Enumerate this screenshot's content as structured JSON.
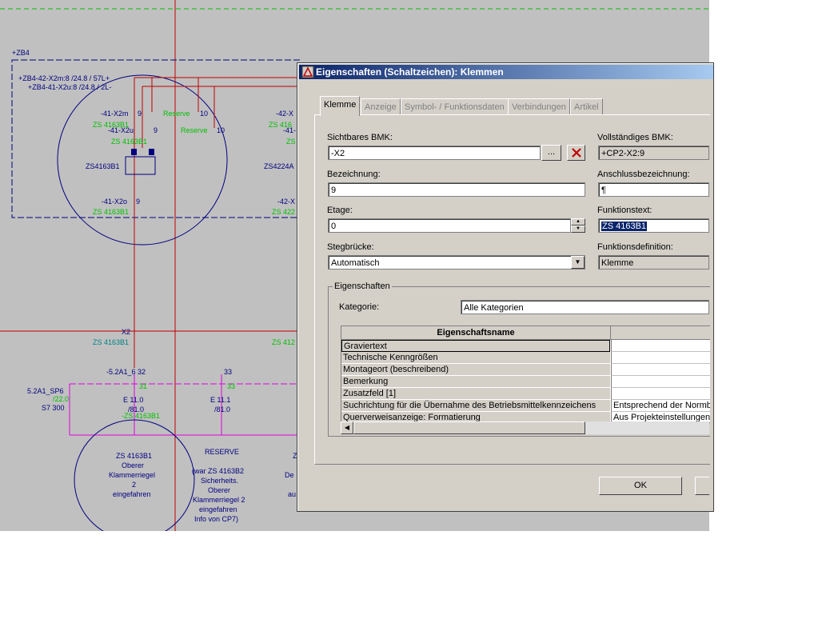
{
  "dialog": {
    "title": "Eigenschaften (Schaltzeichen): Klemmen",
    "tabs": [
      {
        "label": "Klemme"
      },
      {
        "label": "Anzeige"
      },
      {
        "label": "Symbol- / Funktionsdaten"
      },
      {
        "label": "Verbindungen"
      },
      {
        "label": "Artikel"
      }
    ],
    "fields": {
      "sichtbares_bmk": {
        "label": "Sichtbares BMK:",
        "value": "-X2"
      },
      "vollstaendiges_bmk": {
        "label": "Vollständiges BMK:",
        "value": "+CP2-X2:9"
      },
      "bezeichnung": {
        "label": "Bezeichnung:",
        "value": "9"
      },
      "anschlussbezeichnung": {
        "label": "Anschlussbezeichnung:",
        "value": "¶"
      },
      "etage": {
        "label": "Etage:",
        "value": "0"
      },
      "funktionstext": {
        "label": "Funktionstext:",
        "value": "ZS 4163B1"
      },
      "stegbruecke": {
        "label": "Stegbrücke:",
        "value": "Automatisch"
      },
      "funktionsdefinition": {
        "label": "Funktionsdefinition:",
        "value": "Klemme"
      }
    },
    "browse_label": "...",
    "properties": {
      "group_label": "Eigenschaften",
      "kategorie_label": "Kategorie:",
      "kategorie_value": "Alle Kategorien",
      "column_name": "Eigenschaftsname",
      "rows": [
        {
          "name": "Graviertext",
          "value": ""
        },
        {
          "name": "Technische Kenngrößen",
          "value": ""
        },
        {
          "name": "Montageort (beschreibend)",
          "value": ""
        },
        {
          "name": "Bemerkung",
          "value": ""
        },
        {
          "name": "Zusatzfeld [1]",
          "value": ""
        },
        {
          "name": "Suchrichtung für die Übernahme des Betriebsmittelkennzeichens",
          "value": "Entsprechend der Normbl"
        },
        {
          "name": "Querverweisanzeige: Formatierung",
          "value": "Aus Projekteinstellungen"
        }
      ]
    },
    "ok_label": "OK"
  },
  "schematic": {
    "labels": {
      "zb4": "+ZB4",
      "wire1": "+ZB4-42-X2m:8 /24.8 / 57L+",
      "wire2": "+ZB4-41-X2u:8 /24.8 / 2L-",
      "t1": "-41-X2m",
      "t1z": "ZS 4163B1",
      "t2": "-41-X2u",
      "t2z": "ZS 4163B1",
      "reserve1": "Reserve",
      "reserve2": "Reserve",
      "n10a": "10",
      "n10b": "10",
      "n9a": "9",
      "n9b": "9",
      "n9c": "9",
      "dev": "ZS4163B1",
      "t3": "-41-X2o",
      "t3z": "ZS 4163B1",
      "r42a": "-42-X",
      "r42az": "ZS 416",
      "r41": "-41-",
      "r42b": "ZS",
      "dev2": "ZS4224A",
      "r42c": "-42-X",
      "r42cz": "ZS 422",
      "x2": "X2",
      "x2z": "ZS 4163B1",
      "zs412": "ZS 412",
      "spc": "5.2A1_SP6",
      "spc2": "/22.0",
      "s7": "S7 300",
      "in1": "-5.2A1_6",
      "in1n": "32",
      "in1n2": "31",
      "e110": "E 11.0",
      "e110r": "/81.0",
      "e110z": "-ZS 4163B1",
      "in2n": "33",
      "in2n2": "33",
      "e111": "E 11.1",
      "e111r": "/81.0",
      "c1a": "ZS 4163B1",
      "c1b": "Oberer",
      "c1c": "Klammerriegel",
      "c1d": "2",
      "c1e": "eingefahren",
      "res": "RESERVE",
      "r1": "(war ZS 4163B2",
      "r2": "Sicherheits.",
      "r3": "Oberer",
      "r4": "Klammerriegel 2",
      "r5": "eingefahren",
      "r6": "Info von CP7)",
      "zp": "Z",
      "de": "De",
      "au": "au"
    }
  }
}
